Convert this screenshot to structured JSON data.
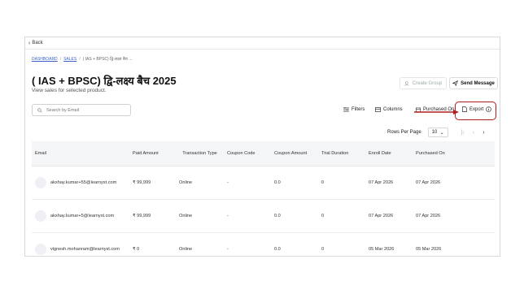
{
  "topbar": {
    "back_label": "Back"
  },
  "breadcrumb": {
    "dashboard": "DASHBOARD",
    "sales": "SALES",
    "current": "( IAS + BPSC) द्वि-लक्ष्य बैच ..."
  },
  "page": {
    "title": "( IAS + BPSC) द्वि-लक्ष्य बैच 2025",
    "subtitle": "View sales for selected product."
  },
  "actions": {
    "create_group": "Create Group",
    "send_message": "Send Message"
  },
  "search": {
    "placeholder": "Search by Email"
  },
  "toolbar": {
    "filters": "Filters",
    "columns": "Columns",
    "purchased_on": "Purchased On",
    "export": "Export"
  },
  "pagination": {
    "rows_per_page_label": "Rows Per Page",
    "rows_per_page_value": "10"
  },
  "table": {
    "headers": {
      "email": "Email",
      "paid_amount": "Paid Amount",
      "transaction_type": "Transaction Type",
      "coupon_code": "Coupon Code",
      "coupon_amount": "Coupon Amount",
      "trial_duration": "Trial Duration",
      "enroll_date": "Enroll Date",
      "purchased_on": "Purchased On"
    },
    "rows": [
      {
        "email": "akshay.kumar+55@learnyst.com",
        "paid": "₹ 99,999",
        "type": "Online",
        "coupon": "-",
        "coupon_amount": "0.0",
        "trial": "0",
        "enroll": "07 Apr 2026",
        "purchased": "07 Apr 2026"
      },
      {
        "email": "akshay.kumar+5@learnyst.com",
        "paid": "₹ 99,999",
        "type": "Online",
        "coupon": "-",
        "coupon_amount": "0.0",
        "trial": "0",
        "enroll": "07 Apr 2026",
        "purchased": "07 Apr 2026"
      },
      {
        "email": "vignesh.mohanram@learnyst.com",
        "paid": "₹ 0",
        "type": "Online",
        "coupon": "-",
        "coupon_amount": "0.0",
        "trial": "0",
        "enroll": "05 Mar 2026",
        "purchased": "05 Mar 2026"
      }
    ]
  },
  "colors": {
    "highlight": "#b11d1d",
    "link": "#3d63c9",
    "header_bg": "#f4f5f7"
  }
}
